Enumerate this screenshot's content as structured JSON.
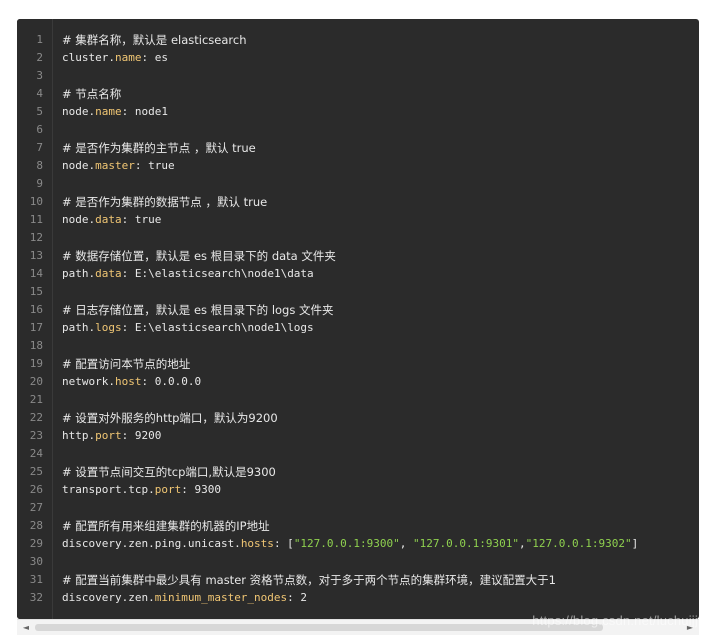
{
  "code": {
    "lines": [
      {
        "n": "1",
        "tokens": [
          {
            "t": "comment",
            "v": "# 集群名称，默认是 elasticsearch"
          }
        ]
      },
      {
        "n": "2",
        "tokens": [
          {
            "t": "plain",
            "v": "cluster."
          },
          {
            "t": "key",
            "v": "name"
          },
          {
            "t": "plain",
            "v": ": es"
          }
        ]
      },
      {
        "n": "3",
        "tokens": []
      },
      {
        "n": "4",
        "tokens": [
          {
            "t": "comment",
            "v": "# 节点名称"
          }
        ]
      },
      {
        "n": "5",
        "tokens": [
          {
            "t": "plain",
            "v": "node."
          },
          {
            "t": "key",
            "v": "name"
          },
          {
            "t": "plain",
            "v": ": node1"
          }
        ]
      },
      {
        "n": "6",
        "tokens": []
      },
      {
        "n": "7",
        "tokens": [
          {
            "t": "comment",
            "v": "# 是否作为集群的主节点 ，默认 true"
          }
        ]
      },
      {
        "n": "8",
        "tokens": [
          {
            "t": "plain",
            "v": "node."
          },
          {
            "t": "key",
            "v": "master"
          },
          {
            "t": "plain",
            "v": ": true"
          }
        ]
      },
      {
        "n": "9",
        "tokens": []
      },
      {
        "n": "10",
        "tokens": [
          {
            "t": "comment",
            "v": "# 是否作为集群的数据节点 ，默认 true"
          }
        ]
      },
      {
        "n": "11",
        "tokens": [
          {
            "t": "plain",
            "v": "node."
          },
          {
            "t": "key",
            "v": "data"
          },
          {
            "t": "plain",
            "v": ": true"
          }
        ]
      },
      {
        "n": "12",
        "tokens": []
      },
      {
        "n": "13",
        "tokens": [
          {
            "t": "comment",
            "v": "# 数据存储位置，默认是 es 根目录下的 data 文件夹"
          }
        ]
      },
      {
        "n": "14",
        "tokens": [
          {
            "t": "plain",
            "v": "path."
          },
          {
            "t": "key",
            "v": "data"
          },
          {
            "t": "plain",
            "v": ": E:\\elasticsearch\\node1\\data"
          }
        ]
      },
      {
        "n": "15",
        "tokens": []
      },
      {
        "n": "16",
        "tokens": [
          {
            "t": "comment",
            "v": "# 日志存储位置，默认是 es 根目录下的 logs 文件夹"
          }
        ]
      },
      {
        "n": "17",
        "tokens": [
          {
            "t": "plain",
            "v": "path."
          },
          {
            "t": "key",
            "v": "logs"
          },
          {
            "t": "plain",
            "v": ": E:\\elasticsearch\\node1\\logs"
          }
        ]
      },
      {
        "n": "18",
        "tokens": []
      },
      {
        "n": "19",
        "tokens": [
          {
            "t": "comment",
            "v": "# 配置访问本节点的地址"
          }
        ]
      },
      {
        "n": "20",
        "tokens": [
          {
            "t": "plain",
            "v": "network."
          },
          {
            "t": "key",
            "v": "host"
          },
          {
            "t": "plain",
            "v": ": 0.0.0.0"
          }
        ]
      },
      {
        "n": "21",
        "tokens": []
      },
      {
        "n": "22",
        "tokens": [
          {
            "t": "comment",
            "v": "# 设置对外服务的http端口，默认为9200"
          }
        ]
      },
      {
        "n": "23",
        "tokens": [
          {
            "t": "plain",
            "v": "http."
          },
          {
            "t": "key",
            "v": "port"
          },
          {
            "t": "plain",
            "v": ": 9200"
          }
        ]
      },
      {
        "n": "24",
        "tokens": []
      },
      {
        "n": "25",
        "tokens": [
          {
            "t": "comment",
            "v": "# 设置节点间交互的tcp端口,默认是9300"
          }
        ]
      },
      {
        "n": "26",
        "tokens": [
          {
            "t": "plain",
            "v": "transport.tcp."
          },
          {
            "t": "key",
            "v": "port"
          },
          {
            "t": "plain",
            "v": ": 9300"
          }
        ]
      },
      {
        "n": "27",
        "tokens": []
      },
      {
        "n": "28",
        "tokens": [
          {
            "t": "comment",
            "v": "# 配置所有用来组建集群的机器的IP地址"
          }
        ]
      },
      {
        "n": "29",
        "tokens": [
          {
            "t": "plain",
            "v": "discovery.zen.ping.unicast."
          },
          {
            "t": "key",
            "v": "hosts"
          },
          {
            "t": "plain",
            "v": ": ["
          },
          {
            "t": "str",
            "v": "\"127.0.0.1:9300\""
          },
          {
            "t": "plain",
            "v": ", "
          },
          {
            "t": "str",
            "v": "\"127.0.0.1:9301\""
          },
          {
            "t": "plain",
            "v": ","
          },
          {
            "t": "str",
            "v": "\"127.0.0.1:9302\""
          },
          {
            "t": "plain",
            "v": "]"
          }
        ]
      },
      {
        "n": "30",
        "tokens": []
      },
      {
        "n": "31",
        "tokens": [
          {
            "t": "comment",
            "v": "# 配置当前集群中最少具有 master 资格节点数，对于多于两个节点的集群环境，建议配置大于1"
          }
        ]
      },
      {
        "n": "32",
        "tokens": [
          {
            "t": "plain",
            "v": "discovery.zen."
          },
          {
            "t": "key",
            "v": "minimum_master_nodes"
          },
          {
            "t": "plain",
            "v": ": 2"
          }
        ]
      }
    ]
  },
  "scrollbar": {
    "left_arrow": "◄",
    "right_arrow": "►",
    "position_fraction": 0.0,
    "visible_fraction": 0.88
  },
  "watermark": "https://blog.csdn.net/luchuijj",
  "colors": {
    "background": "#2b2b2b",
    "text": "#e8e8e8",
    "key": "#f0c674",
    "string": "#8fd14f",
    "line_number": "#8a8a8a"
  }
}
